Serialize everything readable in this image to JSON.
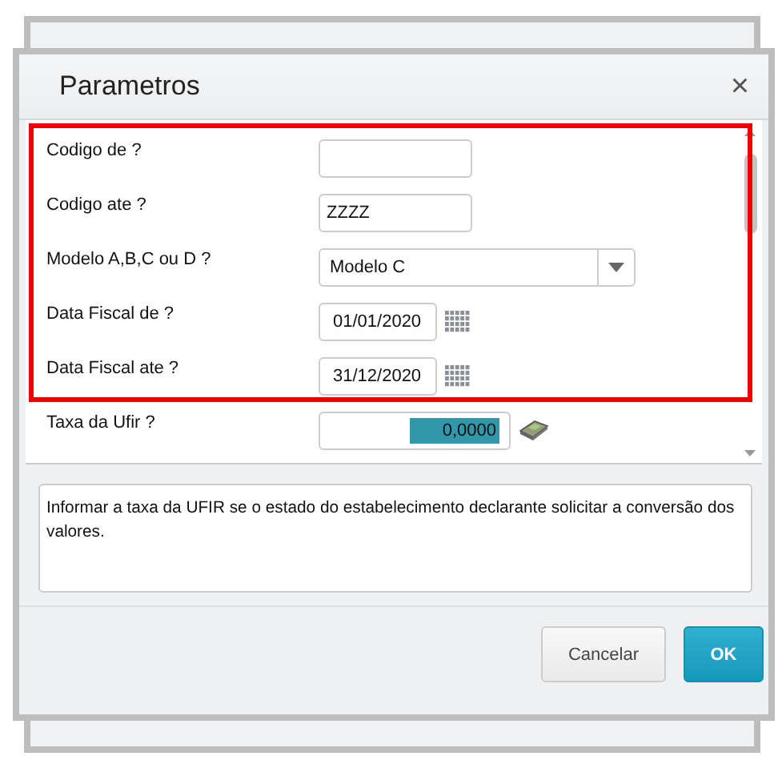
{
  "dialog": {
    "title": "Parametros",
    "close": "×"
  },
  "fields": [
    {
      "label": "Codigo de ?",
      "kind": "text"
    },
    {
      "label": "Codigo ate ?",
      "kind": "text",
      "value": "ZZZZ"
    },
    {
      "label": "Modelo A,B,C ou D ?",
      "kind": "select",
      "value": "Modelo C"
    },
    {
      "label": "Data Fiscal de ?",
      "kind": "date",
      "value": "01/01/2020"
    },
    {
      "label": "Data Fiscal ate ?",
      "kind": "date",
      "value": "31/12/2020"
    },
    {
      "label": "Taxa da Ufir ?",
      "kind": "number",
      "value": "0,0000"
    }
  ],
  "help": "Informar a taxa da UFIR se o estado do estabelecimento declarante solicitar a conversão dos valores.",
  "buttons": [
    {
      "label": "Cancelar",
      "kind": "secondary"
    },
    {
      "label": "OK",
      "kind": "primary"
    }
  ]
}
